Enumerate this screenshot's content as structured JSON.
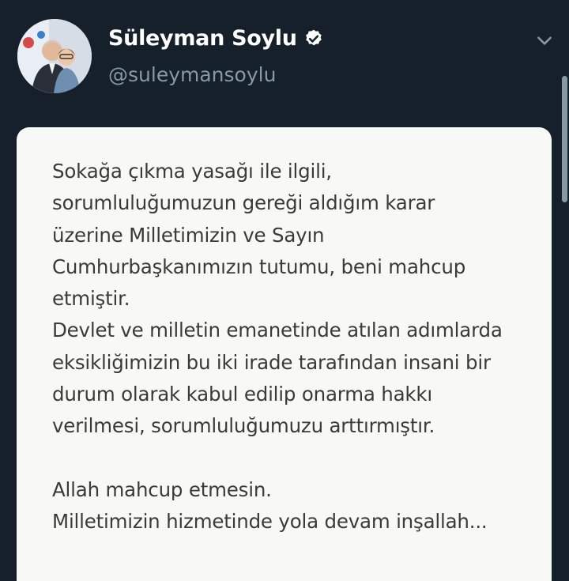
{
  "tweet": {
    "author_name": "Süleyman Soylu",
    "handle": "@suleymansoylu",
    "verified_icon": "verified-badge-icon",
    "menu_icon": "chevron-down-icon",
    "image_text": "Sokağa çıkma yasağı ile ilgili,\nsorumluluğumuzun gereği aldığım karar\nüzerine Milletimizin ve Sayın\nCumhurbaşkanımızın tutumu, beni mahcup\netmiştir.\nDevlet ve milletin emanetinde atılan adımlarda\neksikliğimizin bu iki irade tarafından insani bir\ndurum olarak kabul edilip onarma hakkı\nverilmesi, sorumluluğumuzu arttırmıştır.\n\nAllah mahcup etmesin.\nMilletimizin hizmetinde yola devam inşallah..."
  },
  "colors": {
    "background": "#15202b",
    "name": "#ffffff",
    "handle": "#8899a6",
    "card": "#f8f8f7",
    "card_text": "#3a3a3a"
  }
}
